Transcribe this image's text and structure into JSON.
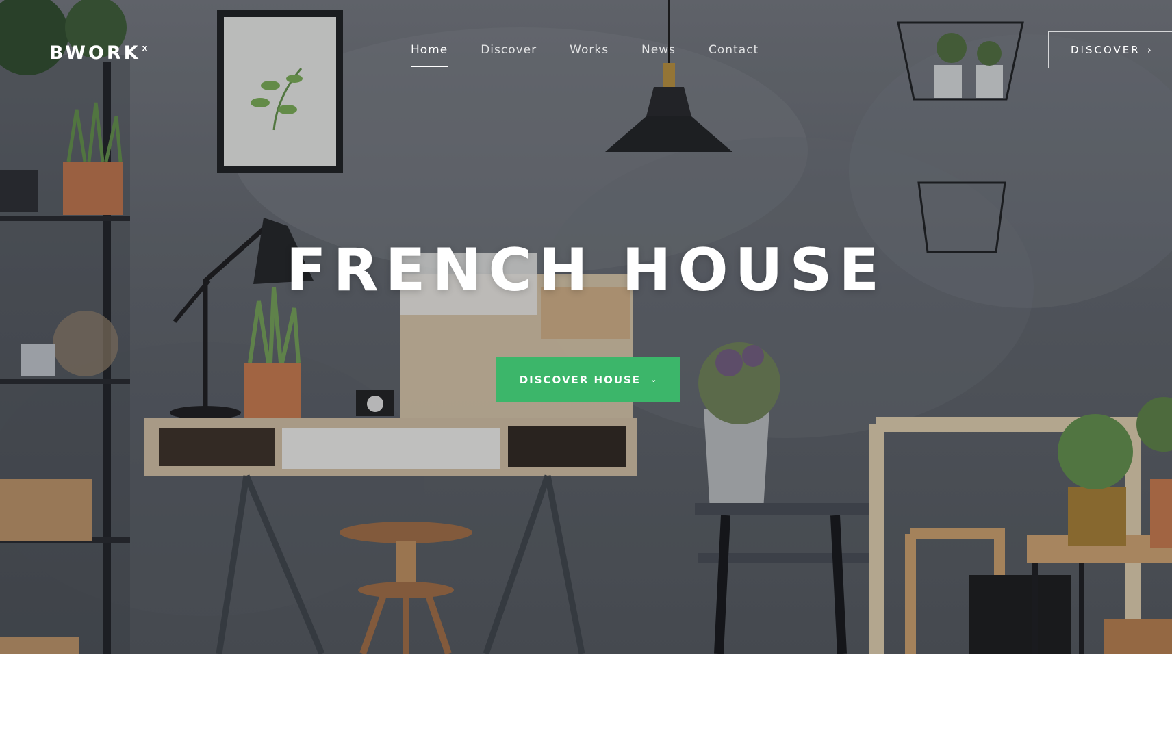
{
  "brand": {
    "logo_text": "BWORK",
    "logo_mark": "x"
  },
  "nav": {
    "items": [
      {
        "label": "Home",
        "active": true
      },
      {
        "label": "Discover",
        "active": false
      },
      {
        "label": "Works",
        "active": false
      },
      {
        "label": "News",
        "active": false
      },
      {
        "label": "Contact",
        "active": false
      }
    ]
  },
  "header_button": {
    "label": "DISCOVER",
    "icon": "chevron-right-icon"
  },
  "hero": {
    "title": "FRENCH HOUSE",
    "cta_label": "DISCOVER HOUSE",
    "cta_icon": "chevron-down-icon",
    "background_image": "workspace-interior-photo"
  },
  "colors": {
    "accent": "#3cb66a",
    "text": "#ffffff",
    "page_background": "#ffffff"
  }
}
